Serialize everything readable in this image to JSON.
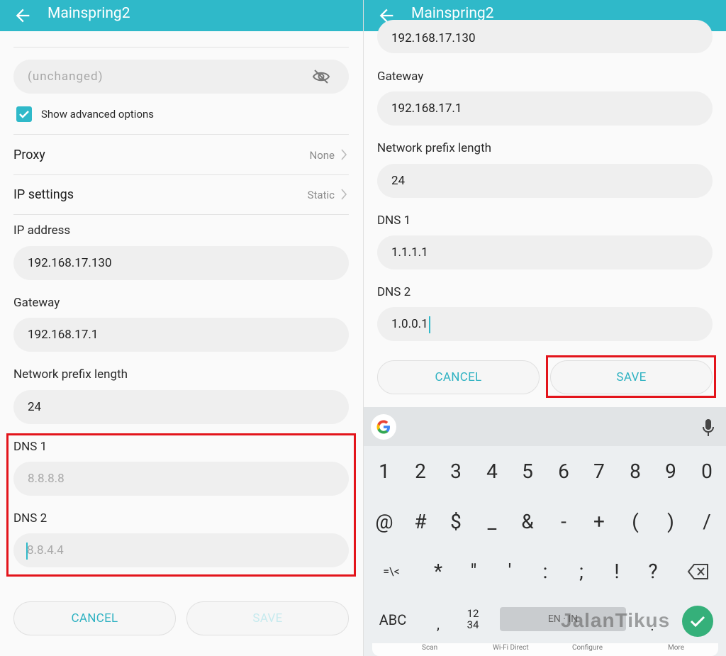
{
  "colors": {
    "accent": "#2fb9c9",
    "highlight": "#e3141b",
    "confirm": "#35b07a"
  },
  "left": {
    "title": "Mainspring2",
    "password_placeholder": "(unchanged)",
    "show_advanced": "Show advanced options",
    "show_advanced_checked": true,
    "proxy": {
      "label": "Proxy",
      "value": "None"
    },
    "ip_settings": {
      "label": "IP settings",
      "value": "Static"
    },
    "ip_address": {
      "label": "IP address",
      "value": "192.168.17.130"
    },
    "gateway": {
      "label": "Gateway",
      "value": "192.168.17.1"
    },
    "prefix": {
      "label": "Network prefix length",
      "value": "24"
    },
    "dns1": {
      "label": "DNS 1",
      "placeholder": "8.8.8.8"
    },
    "dns2": {
      "label": "DNS 2",
      "placeholder": "8.8.4.4"
    },
    "cancel": "CANCEL",
    "save": "SAVE"
  },
  "right": {
    "title": "Mainspring2",
    "ip_value": "192.168.17.130",
    "gateway": {
      "label": "Gateway",
      "value": "192.168.17.1"
    },
    "prefix": {
      "label": "Network prefix length",
      "value": "24"
    },
    "dns1": {
      "label": "DNS 1",
      "value": "1.1.1.1"
    },
    "dns2": {
      "label": "DNS 2",
      "value": "1.0.0.1"
    },
    "cancel": "CANCEL",
    "save": "SAVE",
    "keyboard": {
      "row1": [
        "1",
        "2",
        "3",
        "4",
        "5",
        "6",
        "7",
        "8",
        "9",
        "0"
      ],
      "row2": [
        "@",
        "#",
        "$",
        "_",
        "&",
        "-",
        "+",
        "(",
        ")",
        "/"
      ],
      "row3": [
        "=\\<",
        "*",
        "\"",
        "'",
        ":",
        ";",
        "!",
        "?"
      ],
      "abc": "ABC",
      "comma": ",",
      "numpad": "12\n34",
      "space": "EN · IN",
      "dot": "."
    },
    "nav_peek": [
      "Scan",
      "Wi-Fi Direct",
      "Configure",
      "More"
    ],
    "watermark": "JalanTikus"
  }
}
